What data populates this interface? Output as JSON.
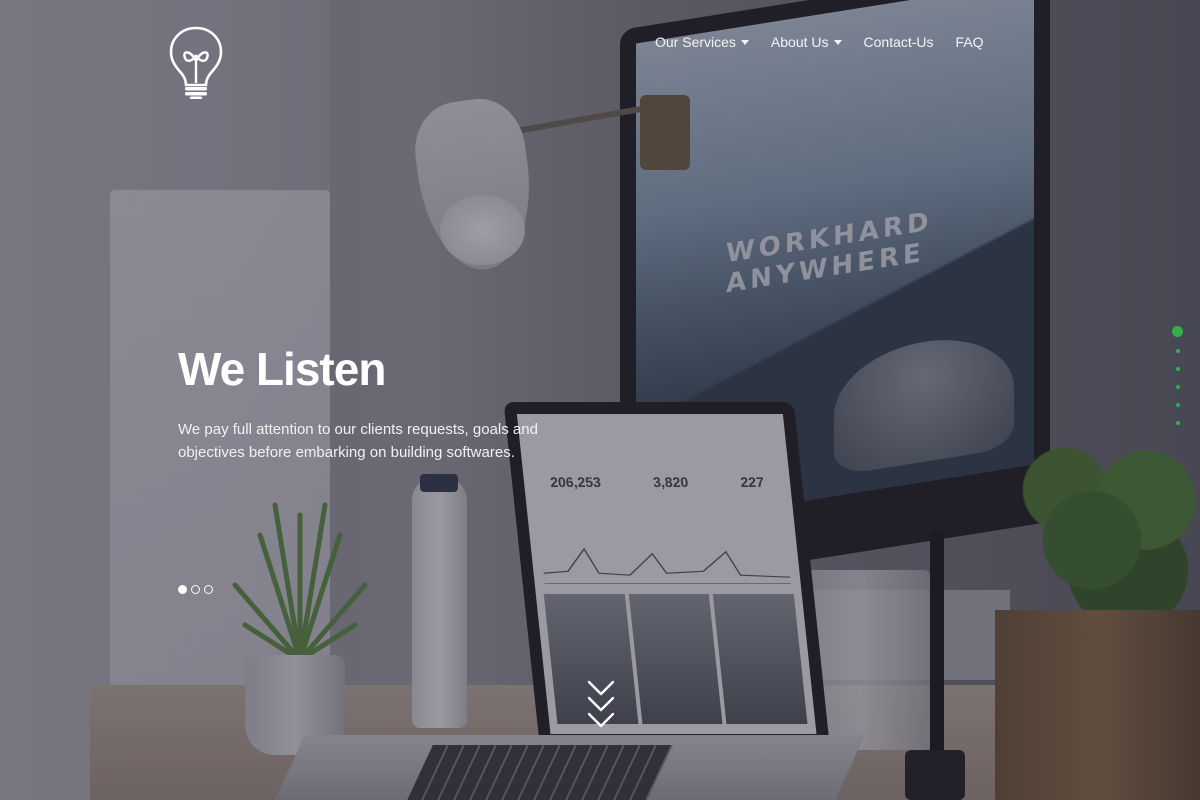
{
  "nav": {
    "items": [
      {
        "label": "Our Services",
        "has_dropdown": true
      },
      {
        "label": "About Us",
        "has_dropdown": true
      },
      {
        "label": "Contact-Us",
        "has_dropdown": false
      },
      {
        "label": "FAQ",
        "has_dropdown": false
      }
    ]
  },
  "logo": {
    "icon": "lightbulb-icon"
  },
  "hero": {
    "title": "We Listen",
    "description": "We pay full attention to our clients requests, goals and objectives before embarking on building softwares.",
    "slide_count": 3,
    "active_slide": 1
  },
  "background": {
    "monitor_text_line1": "WORKHARD",
    "monitor_text_line2": "ANYWHERE",
    "laptop_stats": [
      "206,253",
      "3,820",
      "227"
    ]
  },
  "side_nav": {
    "count": 6,
    "active": 1,
    "color": "#34b04a"
  },
  "scroll_indicator": {
    "icon": "chevron-down-icon"
  }
}
